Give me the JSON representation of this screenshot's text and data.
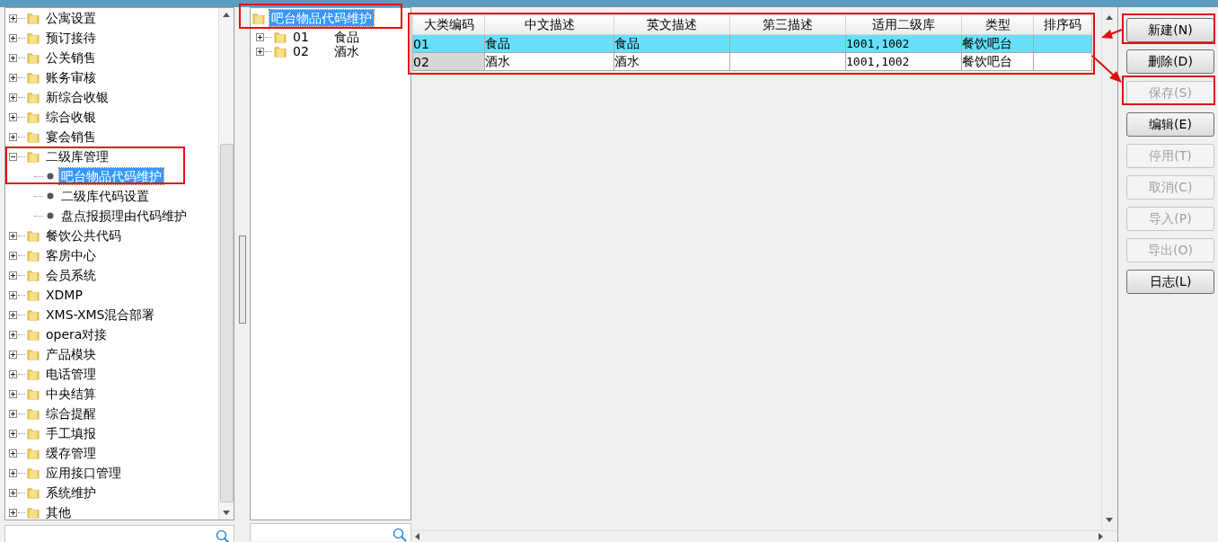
{
  "module_tree": {
    "items": [
      {
        "label": "公寓设置",
        "expanded": false,
        "selected": false
      },
      {
        "label": "预订接待",
        "expanded": false,
        "selected": false
      },
      {
        "label": "公关销售",
        "expanded": false,
        "selected": false
      },
      {
        "label": "账务审核",
        "expanded": false,
        "selected": false
      },
      {
        "label": "新综合收银",
        "expanded": false,
        "selected": false
      },
      {
        "label": "综合收银",
        "expanded": false,
        "selected": false
      },
      {
        "label": "宴会销售",
        "expanded": false,
        "selected": false
      },
      {
        "label": "二级库管理",
        "expanded": true,
        "selected": false,
        "children": [
          {
            "label": "吧台物品代码维护",
            "selected": true
          },
          {
            "label": "二级库代码设置",
            "selected": false
          },
          {
            "label": "盘点报损理由代码维护",
            "selected": false
          }
        ]
      },
      {
        "label": "餐饮公共代码",
        "expanded": false,
        "selected": false
      },
      {
        "label": "客房中心",
        "expanded": false,
        "selected": false
      },
      {
        "label": "会员系统",
        "expanded": false,
        "selected": false
      },
      {
        "label": "XDMP",
        "expanded": false,
        "selected": false
      },
      {
        "label": "XMS-XMS混合部署",
        "expanded": false,
        "selected": false
      },
      {
        "label": "opera对接",
        "expanded": false,
        "selected": false
      },
      {
        "label": "产品模块",
        "expanded": false,
        "selected": false
      },
      {
        "label": "电话管理",
        "expanded": false,
        "selected": false
      },
      {
        "label": "中央结算",
        "expanded": false,
        "selected": false
      },
      {
        "label": "综合提醒",
        "expanded": false,
        "selected": false
      },
      {
        "label": "手工填报",
        "expanded": false,
        "selected": false
      },
      {
        "label": "缓存管理",
        "expanded": false,
        "selected": false
      },
      {
        "label": "应用接口管理",
        "expanded": false,
        "selected": false
      },
      {
        "label": "系统维护",
        "expanded": false,
        "selected": false
      },
      {
        "label": "其他",
        "expanded": false,
        "selected": false
      }
    ]
  },
  "category_tree": {
    "root": {
      "label": "吧台物品代码维护",
      "selected": true,
      "children": [
        {
          "code": "01",
          "label": "食品",
          "expanded": false,
          "selected": false
        },
        {
          "code": "02",
          "label": "酒水",
          "expanded": false,
          "selected": false
        }
      ]
    }
  },
  "table": {
    "columns": [
      "大类编码",
      "中文描述",
      "英文描述",
      "第三描述",
      "适用二级库",
      "类型",
      "排序码"
    ],
    "rows": [
      {
        "selected": true,
        "cells": [
          "01",
          "食品",
          "食品",
          "",
          "1001,1002",
          "餐饮吧台",
          ""
        ]
      },
      {
        "selected": false,
        "cells": [
          "02",
          "酒水",
          "酒水",
          "",
          "1001,1002",
          "餐饮吧台",
          ""
        ]
      }
    ]
  },
  "buttons": [
    {
      "label": "新建(N)",
      "disabled": false
    },
    {
      "label": "删除(D)",
      "disabled": false
    },
    {
      "label": "保存(S)",
      "disabled": true
    },
    {
      "label": "编辑(E)",
      "disabled": false
    },
    {
      "label": "停用(T)",
      "disabled": true
    },
    {
      "label": "取消(C)",
      "disabled": true
    },
    {
      "label": "导入(P)",
      "disabled": true
    },
    {
      "label": "导出(O)",
      "disabled": true
    },
    {
      "label": "日志(L)",
      "disabled": false
    }
  ]
}
